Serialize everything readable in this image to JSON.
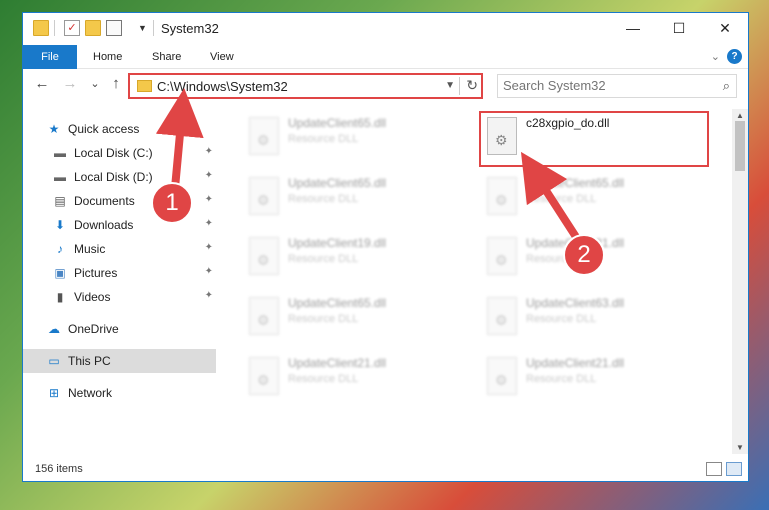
{
  "window": {
    "title": "System32",
    "controls": {
      "minimize": "—",
      "maximize": "☐",
      "close": "✕"
    }
  },
  "ribbon": {
    "tabs": [
      "File",
      "Home",
      "Share",
      "View"
    ],
    "expand": "⌄",
    "help": "?"
  },
  "navbar": {
    "back": "←",
    "forward": "→",
    "recent": "⌄",
    "up": "↑",
    "address": "C:\\Windows\\System32",
    "refresh": "↻",
    "search_placeholder": "Search System32"
  },
  "sidebar": {
    "items": [
      {
        "label": "Quick access",
        "icon": "star-icon",
        "glyph": "★",
        "color": "#1979ca"
      },
      {
        "label": "Local Disk (C:)",
        "icon": "drive-icon",
        "glyph": "▬",
        "color": "#666",
        "pinned": true
      },
      {
        "label": "Local Disk (D:)",
        "icon": "drive-icon",
        "glyph": "▬",
        "color": "#666",
        "pinned": true
      },
      {
        "label": "Documents",
        "icon": "documents-icon",
        "glyph": "▤",
        "color": "#555",
        "pinned": true
      },
      {
        "label": "Downloads",
        "icon": "download-icon",
        "glyph": "⬇",
        "color": "#1979ca",
        "pinned": true
      },
      {
        "label": "Music",
        "icon": "music-icon",
        "glyph": "♪",
        "color": "#1979ca",
        "pinned": true
      },
      {
        "label": "Pictures",
        "icon": "pictures-icon",
        "glyph": "▣",
        "color": "#4a86c5",
        "pinned": true
      },
      {
        "label": "Videos",
        "icon": "video-icon",
        "glyph": "▮",
        "color": "#555",
        "pinned": true
      },
      {
        "label": "OneDrive",
        "icon": "cloud-icon",
        "glyph": "☁",
        "color": "#1979ca"
      },
      {
        "label": "This PC",
        "icon": "computer-icon",
        "glyph": "▭",
        "color": "#1979ca",
        "selected": true
      },
      {
        "label": "Network",
        "icon": "network-icon",
        "glyph": "⊞",
        "color": "#1979ca"
      }
    ],
    "pin_glyph": "📌"
  },
  "files": [
    {
      "name": "UpdateClient65.dll",
      "type": "Resource DLL",
      "blurred": true
    },
    {
      "name": "c28xgpio_do.dll",
      "type": "",
      "blurred": false
    },
    {
      "name": "UpdateClient65.dll",
      "type": "Resource DLL",
      "blurred": true
    },
    {
      "name": "UpdateClient65.dll",
      "type": "Resource DLL",
      "blurred": true
    },
    {
      "name": "UpdateClient19.dll",
      "type": "Resource DLL",
      "blurred": true
    },
    {
      "name": "UpdateClient21.dll",
      "type": "Resource DLL",
      "blurred": true
    },
    {
      "name": "UpdateClient65.dll",
      "type": "Resource DLL",
      "blurred": true
    },
    {
      "name": "UpdateClient63.dll",
      "type": "Resource DLL",
      "blurred": true
    },
    {
      "name": "UpdateClient21.dll",
      "type": "Resource DLL",
      "blurred": true
    },
    {
      "name": "UpdateClient21.dll",
      "type": "Resource DLL",
      "blurred": true
    }
  ],
  "status": {
    "item_count": "156 items"
  },
  "annotations": {
    "step1": "1",
    "step2": "2",
    "color": "#e04545"
  }
}
